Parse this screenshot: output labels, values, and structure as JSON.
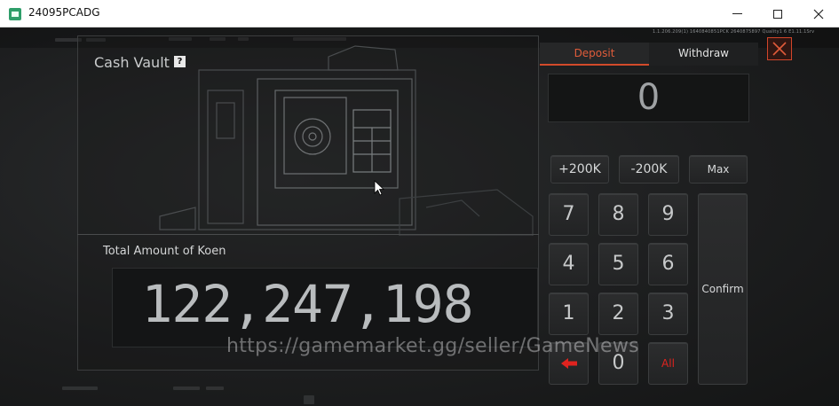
{
  "window": {
    "title": "24095PCADG",
    "minimize_icon": "minimize-icon",
    "maximize_icon": "maximize-icon",
    "close_icon": "close-icon"
  },
  "hud": {
    "build_info": "1.1.206.209(1)  1640840851PCK  2640875897 Quality1 6 E1.11.1Srv",
    "currency_icon": "koen-bills-icon",
    "currency_value": "0"
  },
  "vault": {
    "title": "Cash Vault",
    "help_label": "?",
    "total_label": "Total Amount of Koen",
    "total_value": "122,247,198"
  },
  "transfer": {
    "tabs": [
      {
        "label": "Deposit",
        "active": true
      },
      {
        "label": "Withdraw",
        "active": false
      }
    ],
    "amount": "0",
    "quick_buttons": [
      "+200K",
      "-200K",
      "Max"
    ],
    "keys": [
      "7",
      "8",
      "9",
      "4",
      "5",
      "6",
      "1",
      "2",
      "3",
      "0"
    ],
    "all_label": "All",
    "confirm_label": "Confirm",
    "backspace_icon": "backspace-arrow-icon"
  },
  "watermark": "https://gamemarket.gg/seller/GameNews",
  "colors": {
    "accent": "#d24a2a",
    "danger": "#e0231f",
    "panel_bg": "#1a1b1c"
  }
}
